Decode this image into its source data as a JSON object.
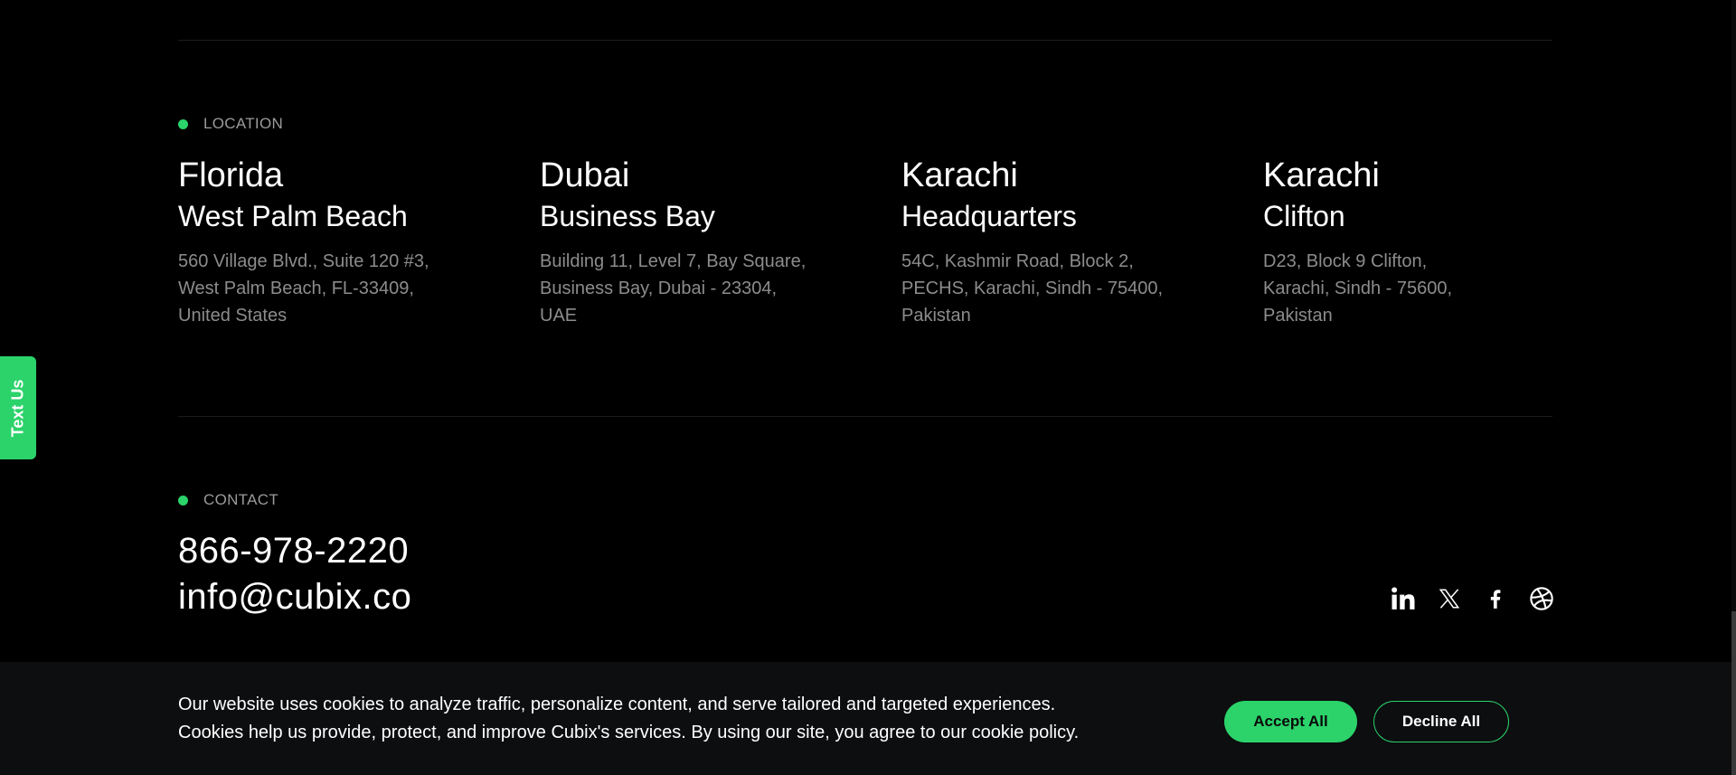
{
  "location": {
    "label": "LOCATION",
    "offices": [
      {
        "city": "Florida",
        "area": "West Palm Beach",
        "address_lines": [
          "560 Village Blvd., Suite 120 #3,",
          "West Palm Beach, FL-33409,",
          "United States"
        ]
      },
      {
        "city": "Dubai",
        "area": "Business Bay",
        "address_lines": [
          "Building 11, Level 7, Bay Square,",
          "Business Bay, Dubai - 23304,",
          "UAE"
        ]
      },
      {
        "city": "Karachi",
        "area": "Headquarters",
        "address_lines": [
          "54C, Kashmir Road, Block 2,",
          "PECHS, Karachi, Sindh - 75400,",
          "Pakistan"
        ]
      },
      {
        "city": "Karachi",
        "area": "Clifton",
        "address_lines": [
          "D23, Block 9 Clifton,",
          "Karachi, Sindh - 75600,",
          "Pakistan"
        ]
      }
    ]
  },
  "contact": {
    "label": "CONTACT",
    "phone": "866-978-2220",
    "email": "info@cubix.co"
  },
  "socials": [
    {
      "icon": "linkedin-icon"
    },
    {
      "icon": "x-twitter-icon"
    },
    {
      "icon": "facebook-icon"
    },
    {
      "icon": "dribbble-icon"
    }
  ],
  "text_us": {
    "label": "Text Us"
  },
  "cookie_banner": {
    "line1": "Our website uses cookies to analyze traffic, personalize content, and serve tailored and targeted experiences.",
    "line2": "Cookies help us provide, protect, and improve Cubix's services. By using our site, you agree to our cookie policy.",
    "accept_label": "Accept All",
    "decline_label": "Decline All"
  },
  "colors": {
    "accent": "#2bd36a",
    "background": "#000000",
    "banner_background": "#0d0e10",
    "muted_text": "#8c8c8c"
  }
}
